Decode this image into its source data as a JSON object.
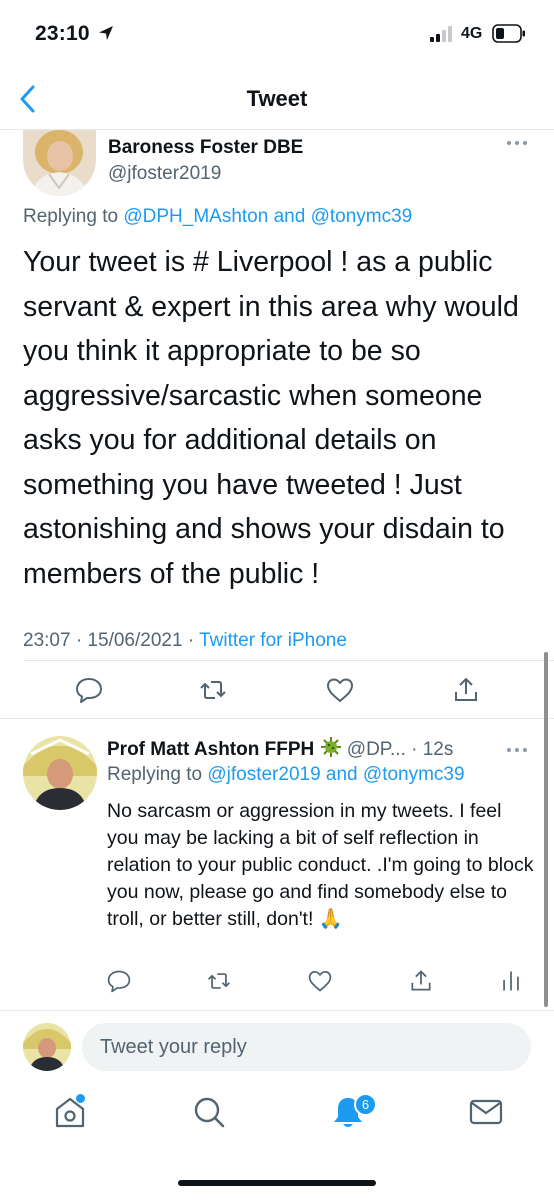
{
  "status_bar": {
    "time": "23:10",
    "network": "4G"
  },
  "nav": {
    "title": "Tweet"
  },
  "main_tweet": {
    "author_name": "Baroness Foster DBE",
    "author_handle": "@jfoster2019",
    "replying_prefix": "Replying to ",
    "replying_user1": "@DPH_MAshton",
    "replying_and": " and ",
    "replying_user2": "@tonymc39",
    "text": "Your tweet is # Liverpool ! as a public servant & expert in this area why would you think it appropriate to be so aggressive/sarcastic when someone asks you for additional details on something you have tweeted ! Just astonishing and shows your disdain to members of the public !",
    "timestamp": "23:07 · 15/06/2021 · ",
    "source": "Twitter for iPhone"
  },
  "reply_tweet": {
    "author_name": "Prof Matt Ashton FFPH",
    "author_handle": "@DP...",
    "time": " · 12s",
    "replying_prefix": "Replying to ",
    "replying_user1": "@jfoster2019",
    "replying_and": " and ",
    "replying_user2": "@tonymc39",
    "text": "No sarcasm or aggression in my tweets. I feel you may be lacking a bit of self reflection in relation to your public conduct. .I'm going to block you now, please go and find somebody else to troll, or better still, don't! 🙏"
  },
  "compose": {
    "placeholder": "Tweet your reply"
  },
  "tab_bar": {
    "notification_count": "6"
  },
  "colors": {
    "accent": "#1d9bf0",
    "text": "#0f1419",
    "secondary": "#536471",
    "divider": "#e7e9ea"
  }
}
